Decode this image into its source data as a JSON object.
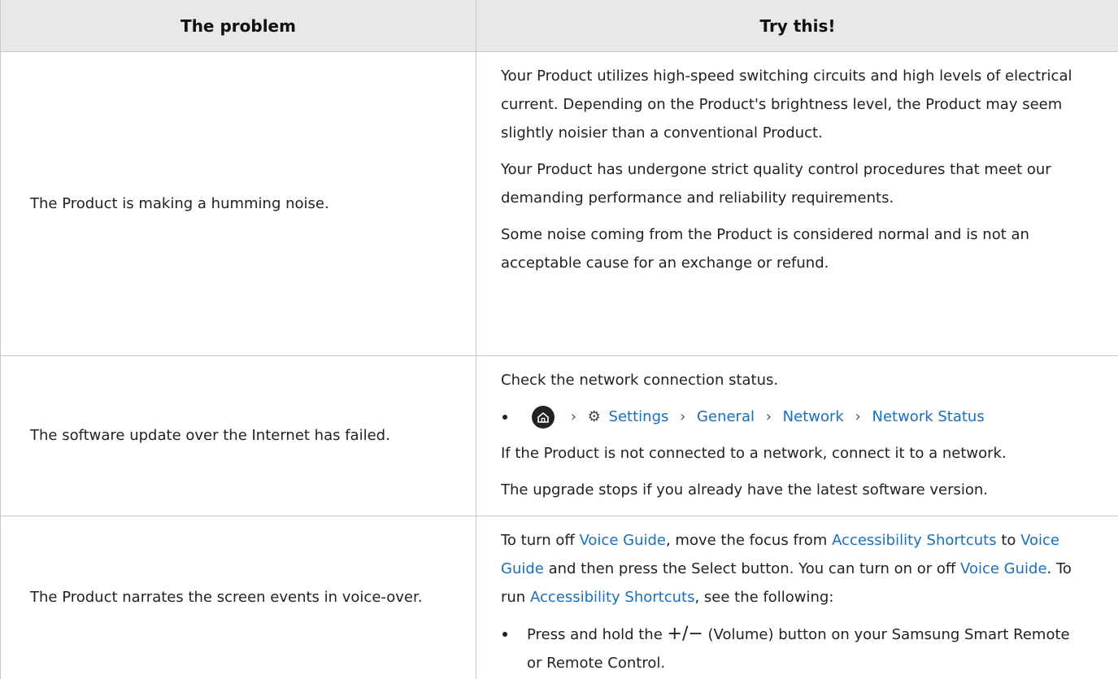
{
  "header": {
    "col1": "The problem",
    "col2": "Try this!"
  },
  "rows": [
    {
      "problem": "The Product is making a humming noise.",
      "para1": "Your Product utilizes high-speed switching circuits and high levels of electrical current. Depending on the Product's brightness level, the Product may seem slightly noisier than a conventional Product.",
      "para2": "Your Product has undergone strict quality control procedures that meet our demanding performance and reliability requirements.",
      "para3": "Some noise coming from the Product is considered normal and is not an acceptable cause for an exchange or refund."
    },
    {
      "problem": "The software update over the Internet has failed.",
      "para1": "Check the network connection status.",
      "path": [
        "Settings",
        "General",
        "Network",
        "Network Status"
      ],
      "para2": "If the Product is not connected to a network, connect it to a network.",
      "para3": "The upgrade stops if you already have the latest software version."
    },
    {
      "problem": "The Product narrates the screen events in voice-over.",
      "p1_a": "To turn off ",
      "p1_link1": "Voice Guide",
      "p1_b": ", move the focus from ",
      "p1_link2": "Accessibility Shortcuts",
      "p1_c": " to ",
      "p1_link3": "Voice Guide",
      "p1_d": " and then press the Select button. You can turn on or off ",
      "p1_link4": "Voice Guide",
      "p1_e": ". To run ",
      "p1_link5": "Accessibility Shortcuts",
      "p1_f": ", see the following:",
      "bullet_a": "Press and hold the ",
      "bullet_symbol": "+/−",
      "bullet_b": " (Volume) button on your Samsung Smart Remote or Remote Control."
    }
  ],
  "colors": {
    "link": "#1a6fba",
    "header_bg": "#e8e8e8",
    "border": "#c8c8c8"
  },
  "icons": {
    "home": "home-icon",
    "settings": "gear-icon",
    "separator": "chevron-right-icon"
  }
}
